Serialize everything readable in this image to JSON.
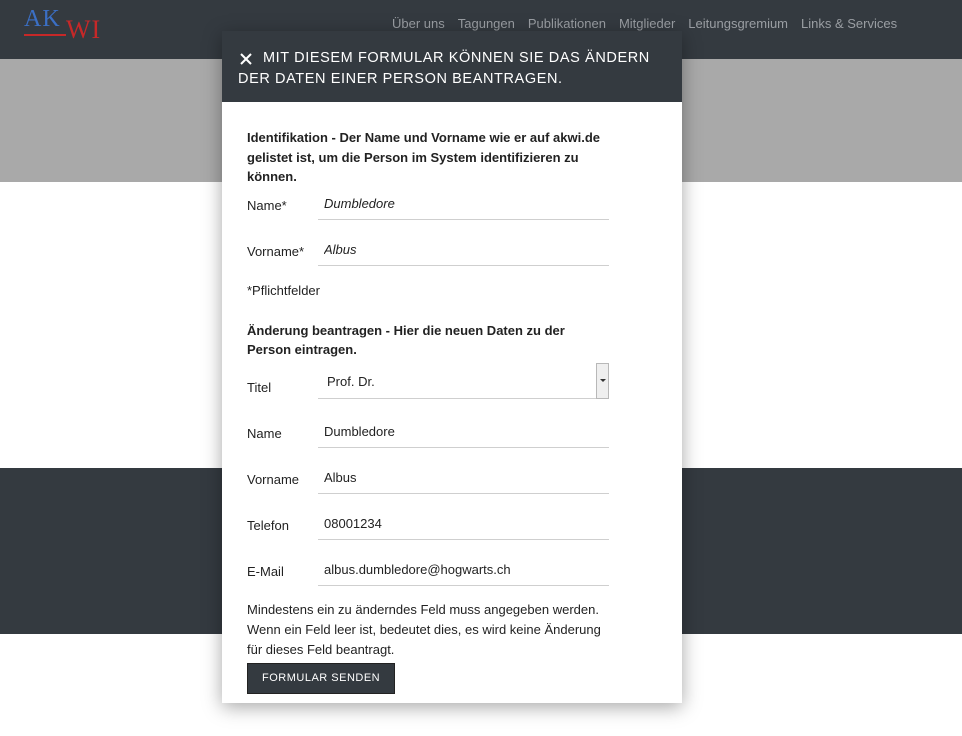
{
  "brand": {
    "logo_ak": "AK",
    "logo_wi": "WI",
    "accent_blue": "#3b6fc4",
    "accent_red": "#c62828"
  },
  "nav": {
    "items": [
      "Über uns",
      "Tagungen",
      "Publikationen",
      "Mitglieder",
      "Leitungsgremium",
      "Links & Services"
    ]
  },
  "modal": {
    "close_icon": "close-icon",
    "title": "Mit diesem Formular können Sie das Ändern der Daten einer Person beantragen.",
    "identification": {
      "heading": "Identifikation - Der Name und Vorname wie er auf akwi.de gelistet ist, um die Person im System identifizieren zu können.",
      "name_label": "Name*",
      "name_value": "Dumbledore",
      "vorname_label": "Vorname*",
      "vorname_value": "Albus",
      "required_note": "*Pflichtfelder"
    },
    "change": {
      "heading": "Änderung beantragen - Hier die neuen Daten zu der Person eintragen.",
      "titel_label": "Titel",
      "titel_value": "Prof. Dr.",
      "name_label": "Name",
      "name_value": "Dumbledore",
      "vorname_label": "Vorname",
      "vorname_value": "Albus",
      "telefon_label": "Telefon",
      "telefon_value": "08001234",
      "email_label": "E-Mail",
      "email_value": "albus.dumbledore@hogwarts.ch"
    },
    "hint": "Mindestens ein zu änderndes Feld muss angegeben werden. Wenn ein Feld leer ist, bedeutet dies, es wird keine Änderung für dieses Feld beantragt.",
    "submit_label": "FORMULAR SENDEN"
  }
}
